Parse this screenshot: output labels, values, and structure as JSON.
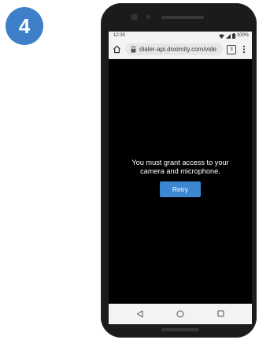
{
  "step": {
    "number": "4",
    "badge_color": "#3d7fc9"
  },
  "status_bar": {
    "time": "12:30",
    "battery": "100%",
    "icons": [
      "wifi-icon",
      "signal-icon",
      "battery-icon"
    ]
  },
  "browser": {
    "url": "dialer-api.doximity.com/vide",
    "tab_count": "3",
    "icons": [
      "home-icon",
      "lock-icon",
      "tab-switcher-icon",
      "menu-icon"
    ]
  },
  "page": {
    "message_line1": "You must grant access to your",
    "message_line2": "camera and microphone.",
    "retry_label": "Retry",
    "button_color": "#3b87d1",
    "background_color": "#000000"
  },
  "nav_bar": {
    "icons": [
      "back-icon",
      "home-circle-icon",
      "recents-icon"
    ]
  }
}
